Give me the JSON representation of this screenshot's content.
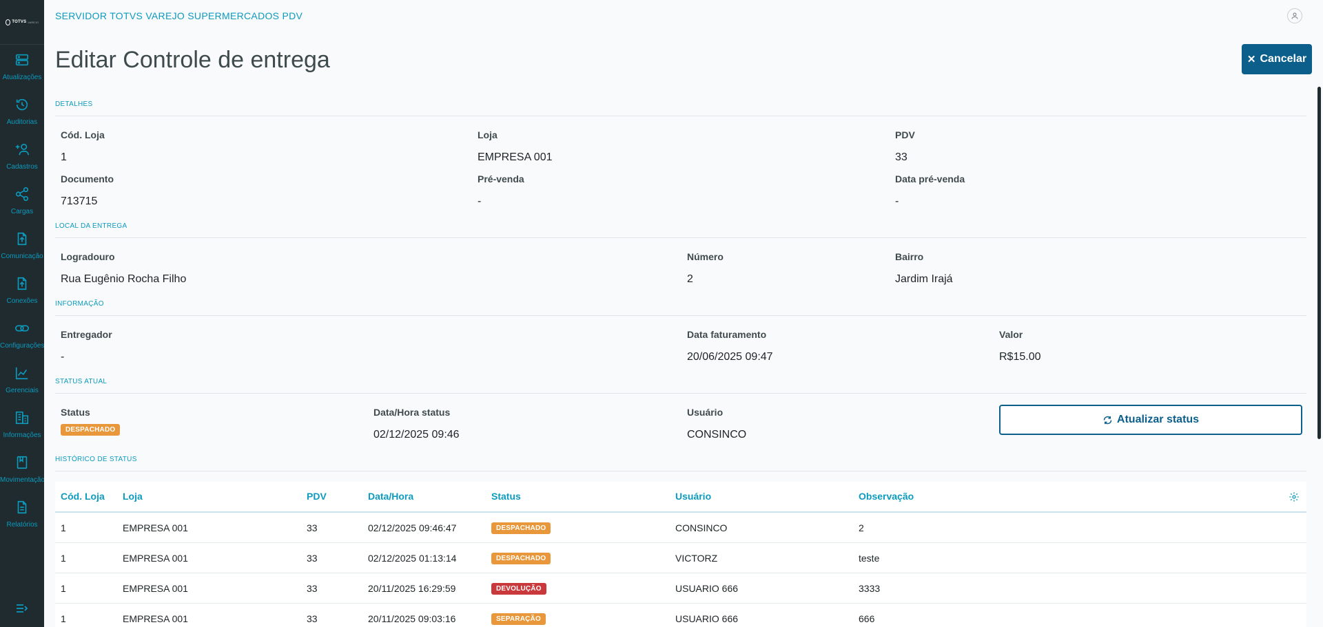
{
  "app": {
    "title": "SERVIDOR TOTVS VAREJO SUPERMERCADOS PDV",
    "logo_text": "TOTVS",
    "logo_sub": "VAREJO"
  },
  "sidebar": {
    "items": [
      {
        "label": "Atualizações",
        "icon": "server-icon"
      },
      {
        "label": "Auditorias",
        "icon": "history-icon"
      },
      {
        "label": "Cadastros",
        "icon": "user-add-icon"
      },
      {
        "label": "Cargas",
        "icon": "share-icon"
      },
      {
        "label": "Comunicação",
        "icon": "file-upload-icon"
      },
      {
        "label": "Conexões",
        "icon": "file-upload-icon"
      },
      {
        "label": "Configurações",
        "icon": "link-icon"
      },
      {
        "label": "Gerenciais",
        "icon": "chart-icon"
      },
      {
        "label": "Informações",
        "icon": "building-icon"
      },
      {
        "label": "Movimentação",
        "icon": "book-icon"
      },
      {
        "label": "Relatórios",
        "icon": "document-icon"
      }
    ]
  },
  "page": {
    "title": "Editar Controle de entrega",
    "cancel_label": "Cancelar"
  },
  "detalhes": {
    "title": "DETALHES",
    "cod_loja_label": "Cód. Loja",
    "cod_loja": "1",
    "loja_label": "Loja",
    "loja": "EMPRESA 001",
    "pdv_label": "PDV",
    "pdv": "33",
    "documento_label": "Documento",
    "documento": "713715",
    "prevenda_label": "Pré-venda",
    "prevenda": "-",
    "data_prevenda_label": "Data pré-venda",
    "data_prevenda": "-"
  },
  "local": {
    "title": "LOCAL DA ENTREGA",
    "logradouro_label": "Logradouro",
    "logradouro": "Rua Eugênio Rocha Filho",
    "numero_label": "Número",
    "numero": "2",
    "bairro_label": "Bairro",
    "bairro": "Jardim Irajá"
  },
  "informacao": {
    "title": "INFORMAÇÃO",
    "entregador_label": "Entregador",
    "entregador": "-",
    "data_faturamento_label": "Data faturamento",
    "data_faturamento": "20/06/2025 09:47",
    "valor_label": "Valor",
    "valor": "R$15.00"
  },
  "status_atual": {
    "title": "STATUS ATUAL",
    "status_label": "Status",
    "status": "DESPACHADO",
    "data_hora_label": "Data/Hora status",
    "data_hora": "02/12/2025 09:46",
    "usuario_label": "Usuário",
    "usuario": "CONSINCO",
    "atualizar_label": "Atualizar status"
  },
  "historico": {
    "title": "HISTÓRICO DE STATUS",
    "columns": [
      "Cód. Loja",
      "Loja",
      "PDV",
      "Data/Hora",
      "Status",
      "Usuário",
      "Observação"
    ],
    "rows": [
      {
        "cod": "1",
        "loja": "EMPRESA 001",
        "pdv": "33",
        "data": "02/12/2025 09:46:47",
        "status": "DESPACHADO",
        "usuario": "CONSINCO",
        "obs": "2"
      },
      {
        "cod": "1",
        "loja": "EMPRESA 001",
        "pdv": "33",
        "data": "02/12/2025 01:13:14",
        "status": "DESPACHADO",
        "usuario": "VICTORZ",
        "obs": "teste"
      },
      {
        "cod": "1",
        "loja": "EMPRESA 001",
        "pdv": "33",
        "data": "20/11/2025 16:29:59",
        "status": "DEVOLUÇÃO",
        "usuario": "USUARIO 666",
        "obs": "3333"
      },
      {
        "cod": "1",
        "loja": "EMPRESA 001",
        "pdv": "33",
        "data": "20/11/2025 09:03:16",
        "status": "SEPARAÇÃO",
        "usuario": "USUARIO 666",
        "obs": "666"
      }
    ]
  },
  "colors": {
    "accent": "#0c9abe",
    "primary": "#0b5f8a",
    "sidebar": "#1f2b2e",
    "badge_orange": "#e8973a",
    "badge_red": "#c9383a"
  }
}
